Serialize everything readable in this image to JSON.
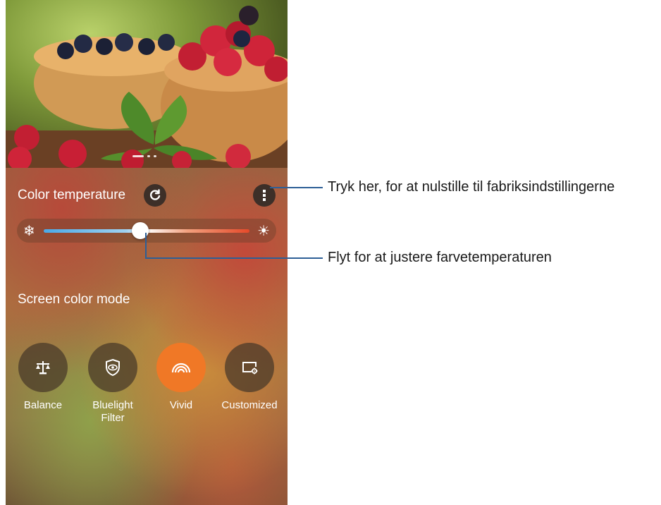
{
  "settings": {
    "color_temperature_label": "Color temperature",
    "screen_color_mode_label": "Screen color mode",
    "slider_level": 0.47
  },
  "modes": [
    {
      "label": "Balance",
      "icon": "scale-icon",
      "active": false
    },
    {
      "label": "Bluelight\nFilter",
      "icon": "eye-shield-icon",
      "active": false
    },
    {
      "label": "Vivid",
      "icon": "rainbow-icon",
      "active": true
    },
    {
      "label": "Customized",
      "icon": "screen-gear-icon",
      "active": false
    }
  ],
  "icons": {
    "reset": "refresh-icon",
    "menu": "more-vertical-icon",
    "cold": "snowflake-icon",
    "warm": "sun-icon"
  },
  "callouts": {
    "menu": "Tryk her, for at nulstille til fabriksindstillingerne",
    "slider": "Flyt for at justere farvetemperaturen"
  },
  "colors": {
    "accent": "#f07826",
    "callout_line": "#2d5f96"
  }
}
